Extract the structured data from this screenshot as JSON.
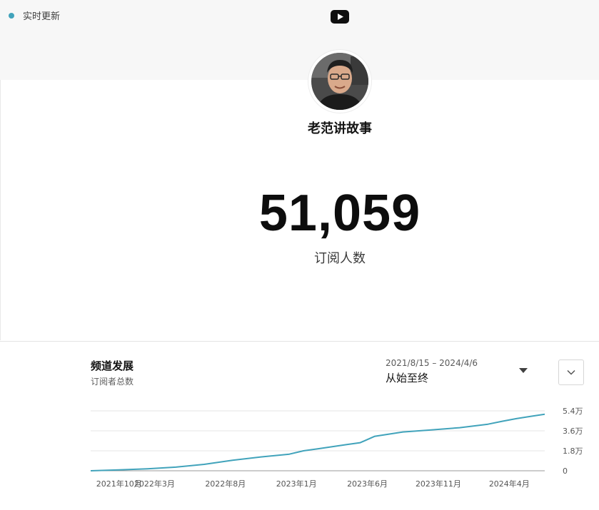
{
  "status": {
    "live_label": "实时更新",
    "live_color": "#41a3bb"
  },
  "header": {
    "logo_icon": "youtube-icon",
    "channel_name": "老范讲故事",
    "avatar_icon": "channel-avatar"
  },
  "stats": {
    "subscriber_count": "51,059",
    "subscriber_label": "订阅人数"
  },
  "growth": {
    "title": "频道发展",
    "subtitle": "订阅者总数",
    "date_range": "2021/8/15 – 2024/4/6",
    "range_label": "从始至终",
    "dropdown_icon": "caret-down-icon",
    "expand_icon": "chevron-down-icon"
  },
  "chart_data": {
    "type": "line",
    "x_tick_labels": [
      "2021年10月",
      "2022年3月",
      "2022年8月",
      "2023年1月",
      "2023年6月",
      "2023年11月",
      "2024年4月"
    ],
    "y_tick_labels": [
      "5.4万",
      "3.6万",
      "1.8万",
      "0"
    ],
    "y_ticks": [
      54000,
      36000,
      18000,
      0
    ],
    "ylim": [
      0,
      54000
    ],
    "x_domain": [
      0,
      32
    ],
    "grid": true,
    "line_color": "#41a3bb",
    "series": [
      {
        "x": [
          0,
          2,
          4,
          6,
          8,
          10,
          12,
          14,
          15,
          16,
          18,
          19,
          20,
          22,
          24,
          26,
          28,
          29,
          30,
          31,
          32
        ],
        "values": [
          0,
          800,
          1800,
          3300,
          5800,
          9500,
          12500,
          15000,
          18000,
          19800,
          23500,
          25300,
          31000,
          35000,
          36800,
          38800,
          42000,
          44600,
          47000,
          49000,
          51000
        ]
      }
    ],
    "x_tick_positions": [
      2,
      4.5,
      9.5,
      14.5,
      19.5,
      24.5,
      29.5
    ]
  }
}
